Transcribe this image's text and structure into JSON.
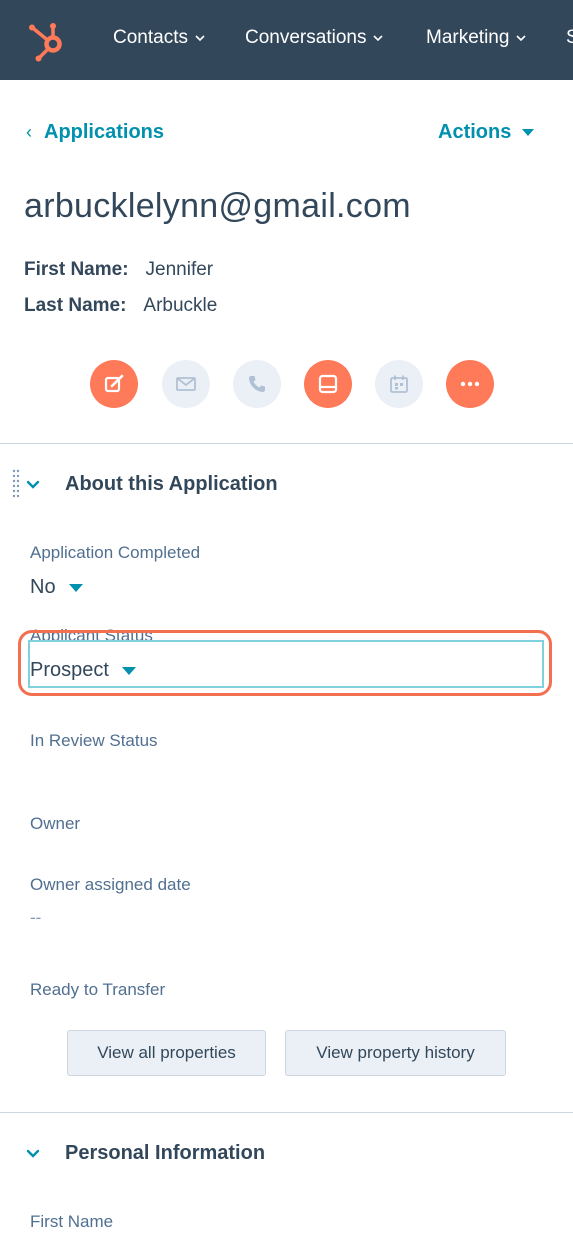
{
  "nav": {
    "items": [
      {
        "label": "Contacts"
      },
      {
        "label": "Conversations"
      },
      {
        "label": "Marketing"
      }
    ],
    "logo_icon": "hubspot-sprocket-icon",
    "colors": {
      "background": "#33475b",
      "brand": "#ff7a59"
    }
  },
  "header": {
    "back_label": "Applications",
    "actions_label": "Actions",
    "title": "arbucklelynn@gmail.com",
    "first_name_label": "First Name:",
    "first_name_value": "Jennifer",
    "last_name_label": "Last Name:",
    "last_name_value": "Arbuckle"
  },
  "quick_actions": [
    {
      "icon": "edit-note-icon",
      "style": "orange"
    },
    {
      "icon": "email-icon",
      "style": "grey"
    },
    {
      "icon": "phone-icon",
      "style": "grey"
    },
    {
      "icon": "log-activity-icon",
      "style": "orange"
    },
    {
      "icon": "calendar-meeting-icon",
      "style": "grey"
    },
    {
      "icon": "more-icon",
      "style": "orange"
    }
  ],
  "section_about": {
    "title": "About this Application",
    "properties": {
      "application_completed": {
        "label": "Application Completed",
        "value": "No"
      },
      "applicant_status": {
        "label": "Applicant Status",
        "value": "Prospect"
      },
      "in_review_status": {
        "label": "In Review Status"
      },
      "owner": {
        "label": "Owner"
      },
      "owner_assigned_date": {
        "label": "Owner assigned date",
        "value": "--"
      },
      "ready_to_transfer": {
        "label": "Ready to Transfer"
      }
    },
    "buttons": {
      "view_all": "View all properties",
      "view_history": "View property history"
    }
  },
  "section_personal": {
    "title": "Personal Information",
    "first_field_label": "First Name"
  },
  "colors": {
    "link": "#0091ae",
    "text": "#33475b",
    "highlight": "#f2704f",
    "focus_border": "#7fd1de"
  }
}
